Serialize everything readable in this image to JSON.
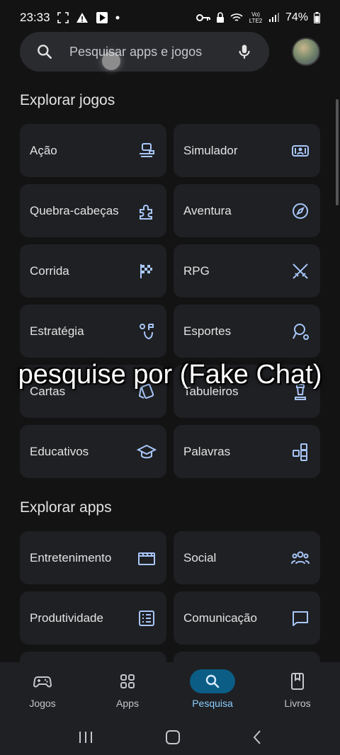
{
  "status_bar": {
    "time": "23:33",
    "battery": "74%",
    "network": "Vo) LTE2"
  },
  "search": {
    "placeholder": "Pesquisar apps e jogos"
  },
  "games_section": {
    "title": "Explorar jogos",
    "items": [
      {
        "label": "Ação",
        "icon": "gamepad-player-icon"
      },
      {
        "label": "Simulador",
        "icon": "simulator-icon"
      },
      {
        "label": "Quebra-cabeças",
        "icon": "puzzle-icon"
      },
      {
        "label": "Aventura",
        "icon": "compass-icon"
      },
      {
        "label": "Corrida",
        "icon": "checkered-flag-icon"
      },
      {
        "label": "RPG",
        "icon": "crossed-swords-icon"
      },
      {
        "label": "Estratégia",
        "icon": "strategy-icon"
      },
      {
        "label": "Esportes",
        "icon": "sports-icon"
      },
      {
        "label": "Cartas",
        "icon": "cards-icon"
      },
      {
        "label": "Tabuleiros",
        "icon": "chess-piece-icon"
      },
      {
        "label": "Educativos",
        "icon": "graduation-cap-icon"
      },
      {
        "label": "Palavras",
        "icon": "letter-tiles-icon"
      }
    ]
  },
  "apps_section": {
    "title": "Explorar apps",
    "items": [
      {
        "label": "Entretenimento",
        "icon": "clapperboard-icon"
      },
      {
        "label": "Social",
        "icon": "people-icon"
      },
      {
        "label": "Produtividade",
        "icon": "checklist-icon"
      },
      {
        "label": "Comunicação",
        "icon": "chat-bubble-icon"
      }
    ]
  },
  "overlay": {
    "caption": "pesquise por (Fake Chat)"
  },
  "bottom_nav": {
    "items": [
      {
        "label": "Jogos",
        "active": false
      },
      {
        "label": "Apps",
        "active": false
      },
      {
        "label": "Pesquisa",
        "active": true
      },
      {
        "label": "Livros",
        "active": false
      }
    ]
  },
  "colors": {
    "background": "#131314",
    "card": "#1f2023",
    "icon": "#a8c7fa",
    "active_nav": "#0b5d85"
  }
}
